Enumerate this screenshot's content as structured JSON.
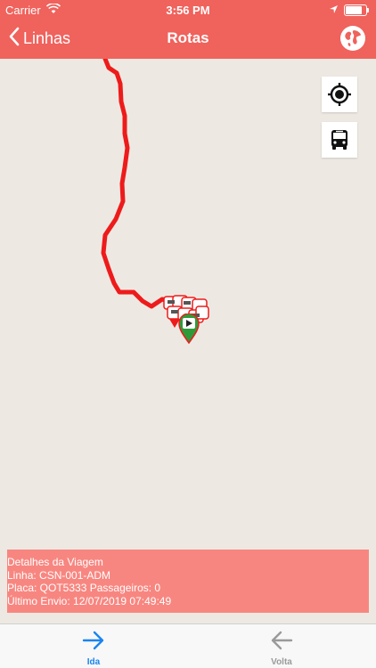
{
  "status_bar": {
    "carrier": "Carrier",
    "time": "3:56 PM"
  },
  "nav": {
    "back_label": "Linhas",
    "title": "Rotas"
  },
  "map": {
    "route_color": "#ee1b1b",
    "locate_icon": "crosshair-target-icon",
    "bus_icon": "bus-icon"
  },
  "details": {
    "heading": "Detalhes da Viagem",
    "line": "Linha: CSN-001-ADM",
    "plate_passengers": "Placa: QOT5333 Passageiros: 0",
    "last_sent": "Último Envio: 12/07/2019 07:49:49"
  },
  "tabs": [
    {
      "label": "Ida",
      "icon": "arrow-right-icon",
      "active": true,
      "color": "#1a84f0"
    },
    {
      "label": "Volta",
      "icon": "arrow-left-icon",
      "active": false,
      "color": "#9a9a9a"
    }
  ],
  "colors": {
    "header": "#f0625c",
    "details_bg": "#f88680",
    "active_tab": "#1a84f0",
    "inactive_tab": "#9a9a9a"
  }
}
